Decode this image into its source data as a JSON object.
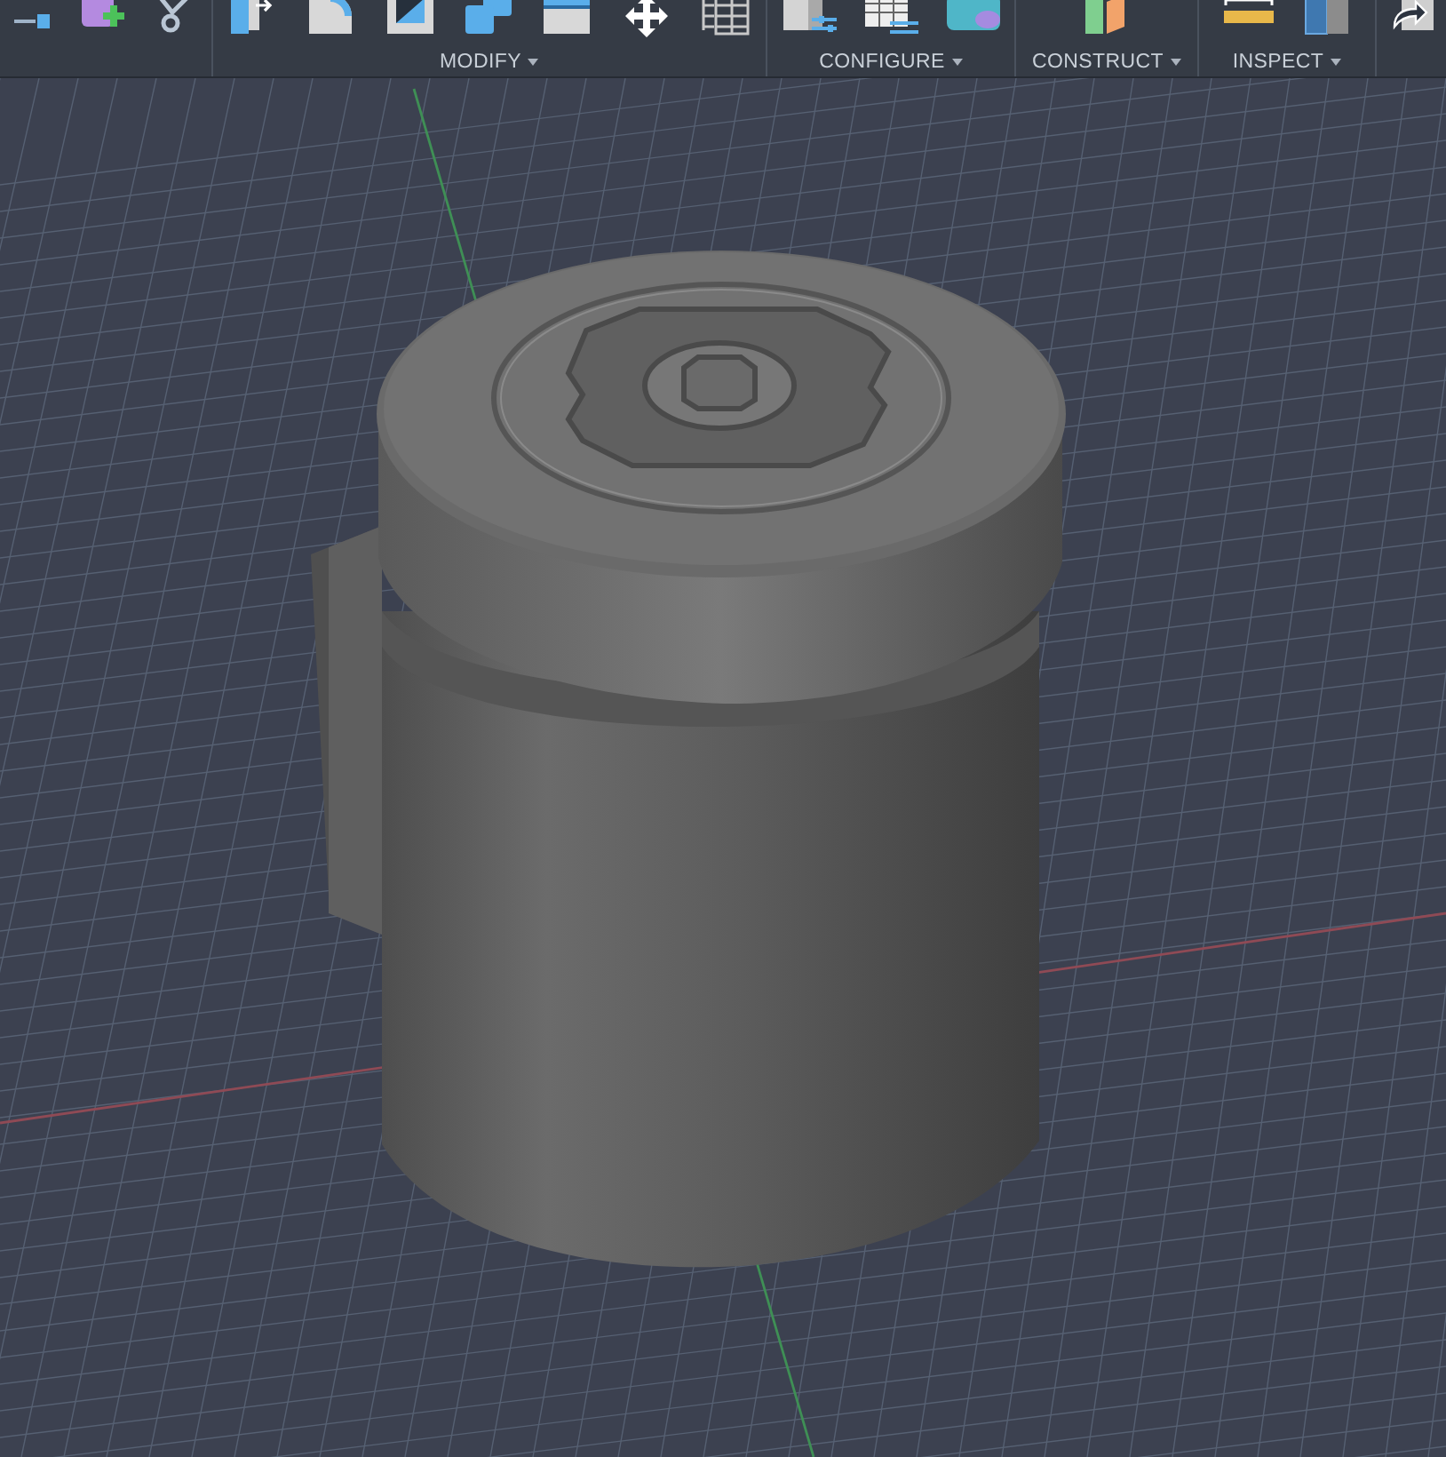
{
  "toolbar": {
    "groups": [
      {
        "label": "MODIFY"
      },
      {
        "label": "CONFIGURE"
      },
      {
        "label": "CONSTRUCT"
      },
      {
        "label": "INSPECT"
      }
    ]
  }
}
